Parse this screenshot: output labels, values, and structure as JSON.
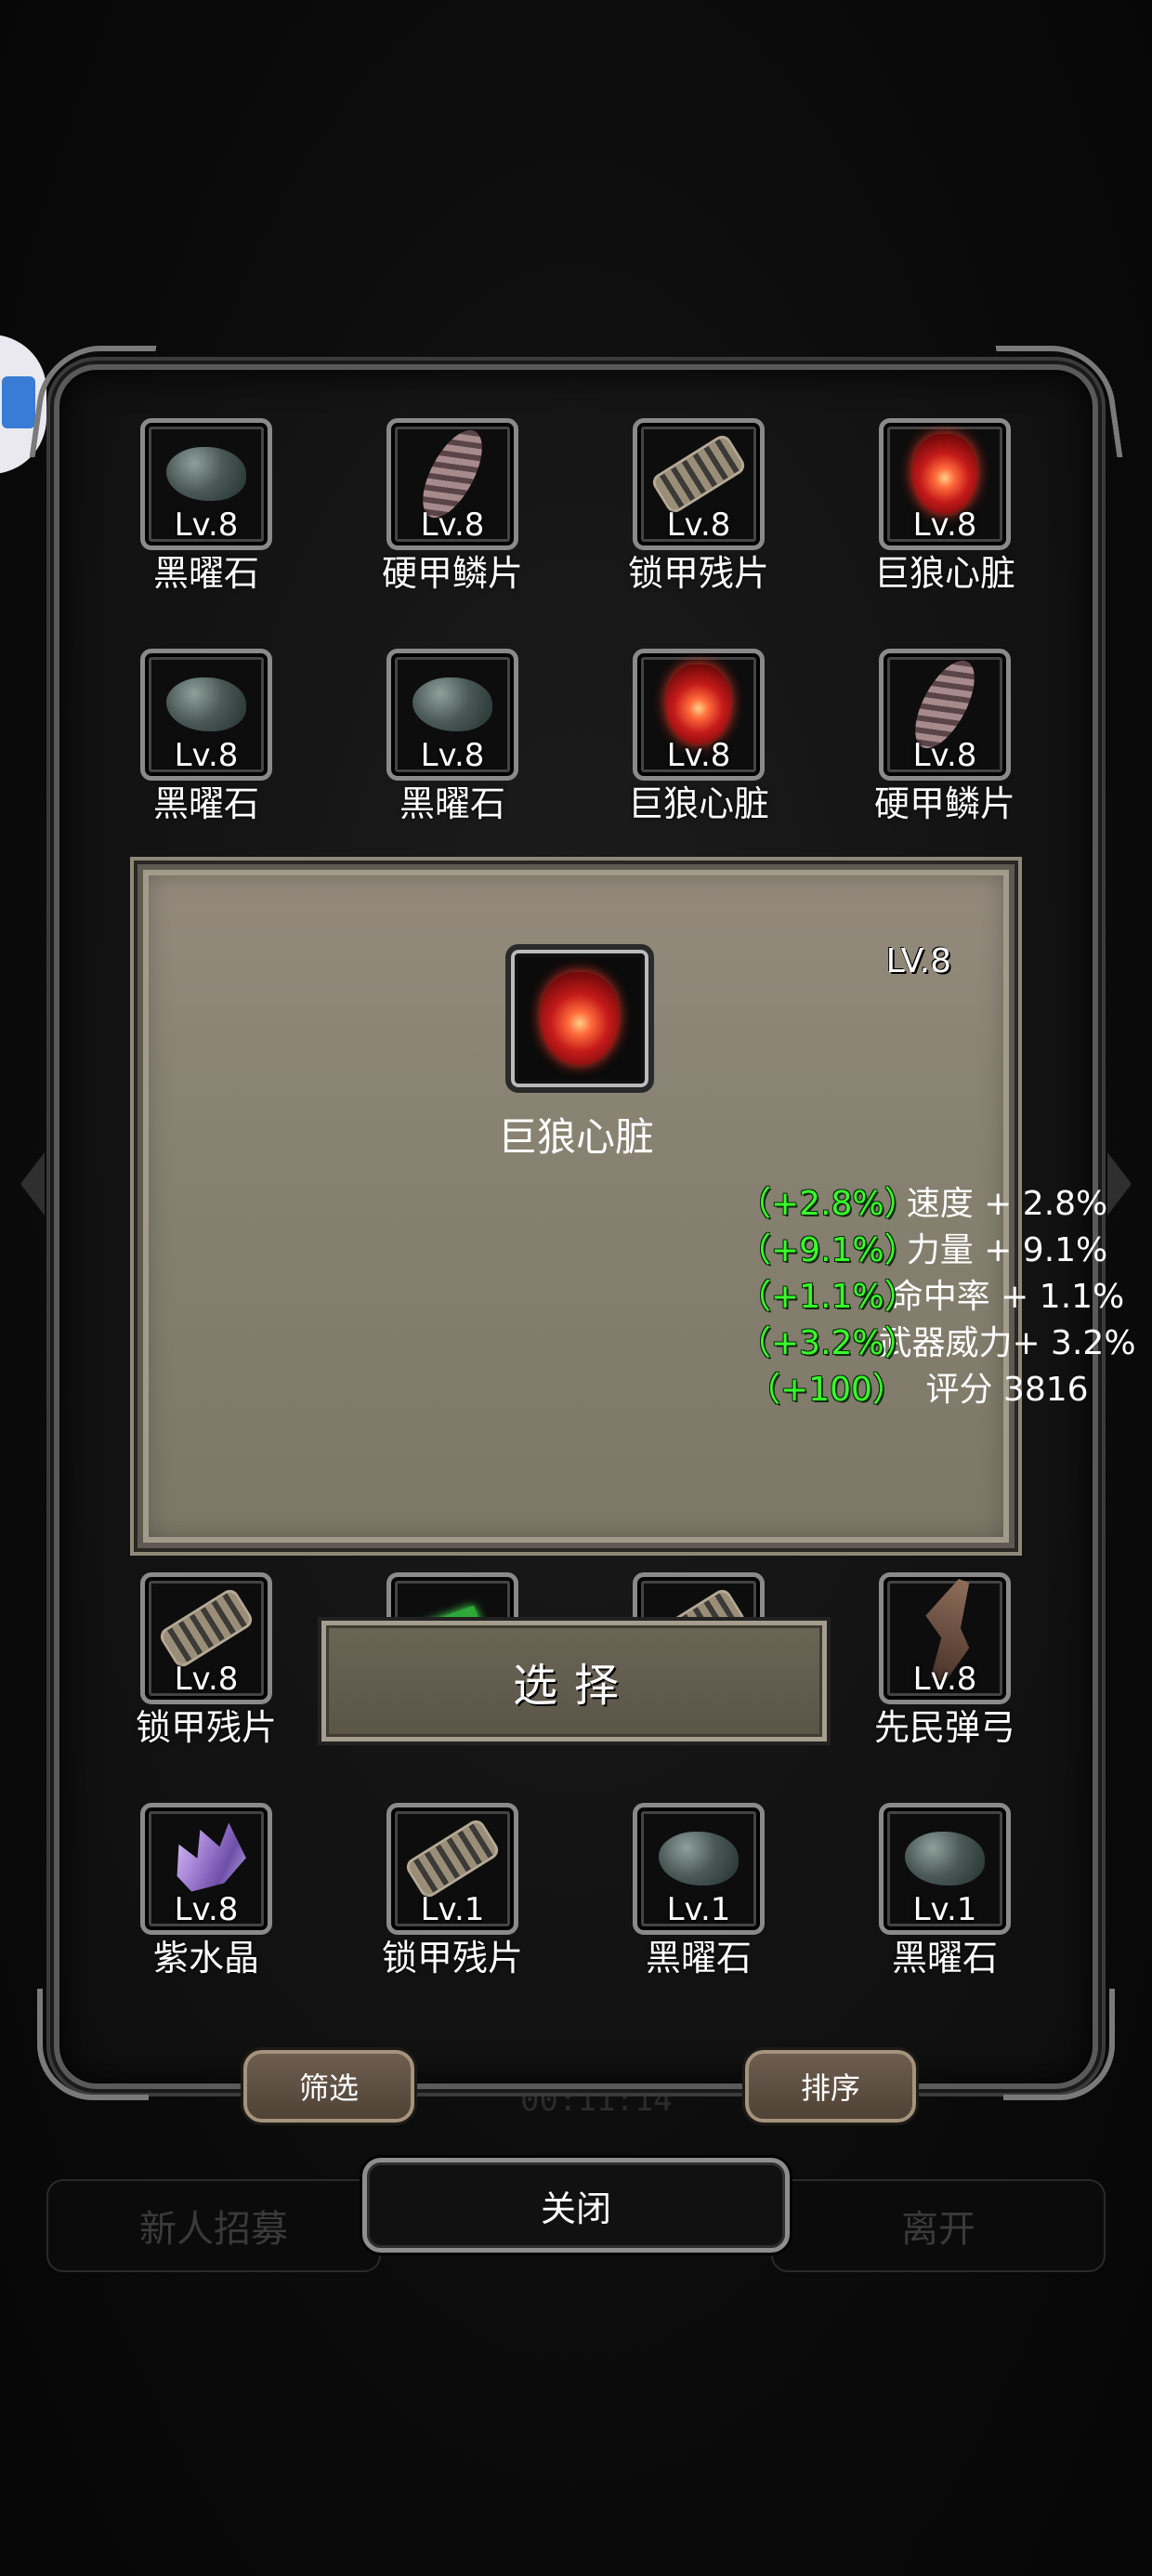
{
  "background": {
    "left_button": "新人招募",
    "right_button": "离开",
    "timer": "00:11:14"
  },
  "grid": {
    "rows": [
      [
        {
          "level": "Lv.8",
          "name": "黑曜石",
          "icon": "obsidian-icon"
        },
        {
          "level": "Lv.8",
          "name": "硬甲鳞片",
          "icon": "scale-icon"
        },
        {
          "level": "Lv.8",
          "name": "锁甲残片",
          "icon": "chain-icon"
        },
        {
          "level": "Lv.8",
          "name": "巨狼心脏",
          "icon": "heart-icon"
        }
      ],
      [
        {
          "level": "Lv.8",
          "name": "黑曜石",
          "icon": "obsidian-icon"
        },
        {
          "level": "Lv.8",
          "name": "黑曜石",
          "icon": "obsidian-icon"
        },
        {
          "level": "Lv.8",
          "name": "巨狼心脏",
          "icon": "heart-icon"
        },
        {
          "level": "Lv.8",
          "name": "硬甲鳞片",
          "icon": "scale-icon"
        }
      ],
      [
        {
          "level": "Lv.8",
          "name": "锁甲残片",
          "icon": "chain-icon"
        },
        {
          "level": "",
          "name": "",
          "icon": "gem-green-icon"
        },
        {
          "level": "",
          "name": "",
          "icon": "chain-icon"
        },
        {
          "level": "Lv.8",
          "name": "先民弹弓",
          "icon": "bow-icon"
        }
      ],
      [
        {
          "level": "Lv.8",
          "name": "紫水晶",
          "icon": "crystal-icon"
        },
        {
          "level": "Lv.1",
          "name": "锁甲残片",
          "icon": "chain-icon"
        },
        {
          "level": "Lv.1",
          "name": "黑曜石",
          "icon": "obsidian-icon"
        },
        {
          "level": "Lv.1",
          "name": "黑曜石",
          "icon": "obsidian-icon"
        }
      ]
    ]
  },
  "detail": {
    "level": "LV.8",
    "icon": "heart-icon",
    "name": "巨狼心脏",
    "stats": [
      {
        "label": "速度 + 2.8%",
        "bonus": "（+2.8%）"
      },
      {
        "label": "力量 + 9.1%",
        "bonus": "（+9.1%）"
      },
      {
        "label": "命中率 + 1.1%",
        "bonus": "（+1.1%）"
      },
      {
        "label": "武器威力+ 3.2%",
        "bonus": "（+3.2%）"
      },
      {
        "label": "评分 3816",
        "bonus": "（+100）"
      }
    ],
    "select_label": "选择"
  },
  "footer": {
    "filter_label": "筛选",
    "sort_label": "排序",
    "close_label": "关闭"
  },
  "colors": {
    "bonus_green": "#39ff2c",
    "popup_bg": "#8a8474"
  }
}
